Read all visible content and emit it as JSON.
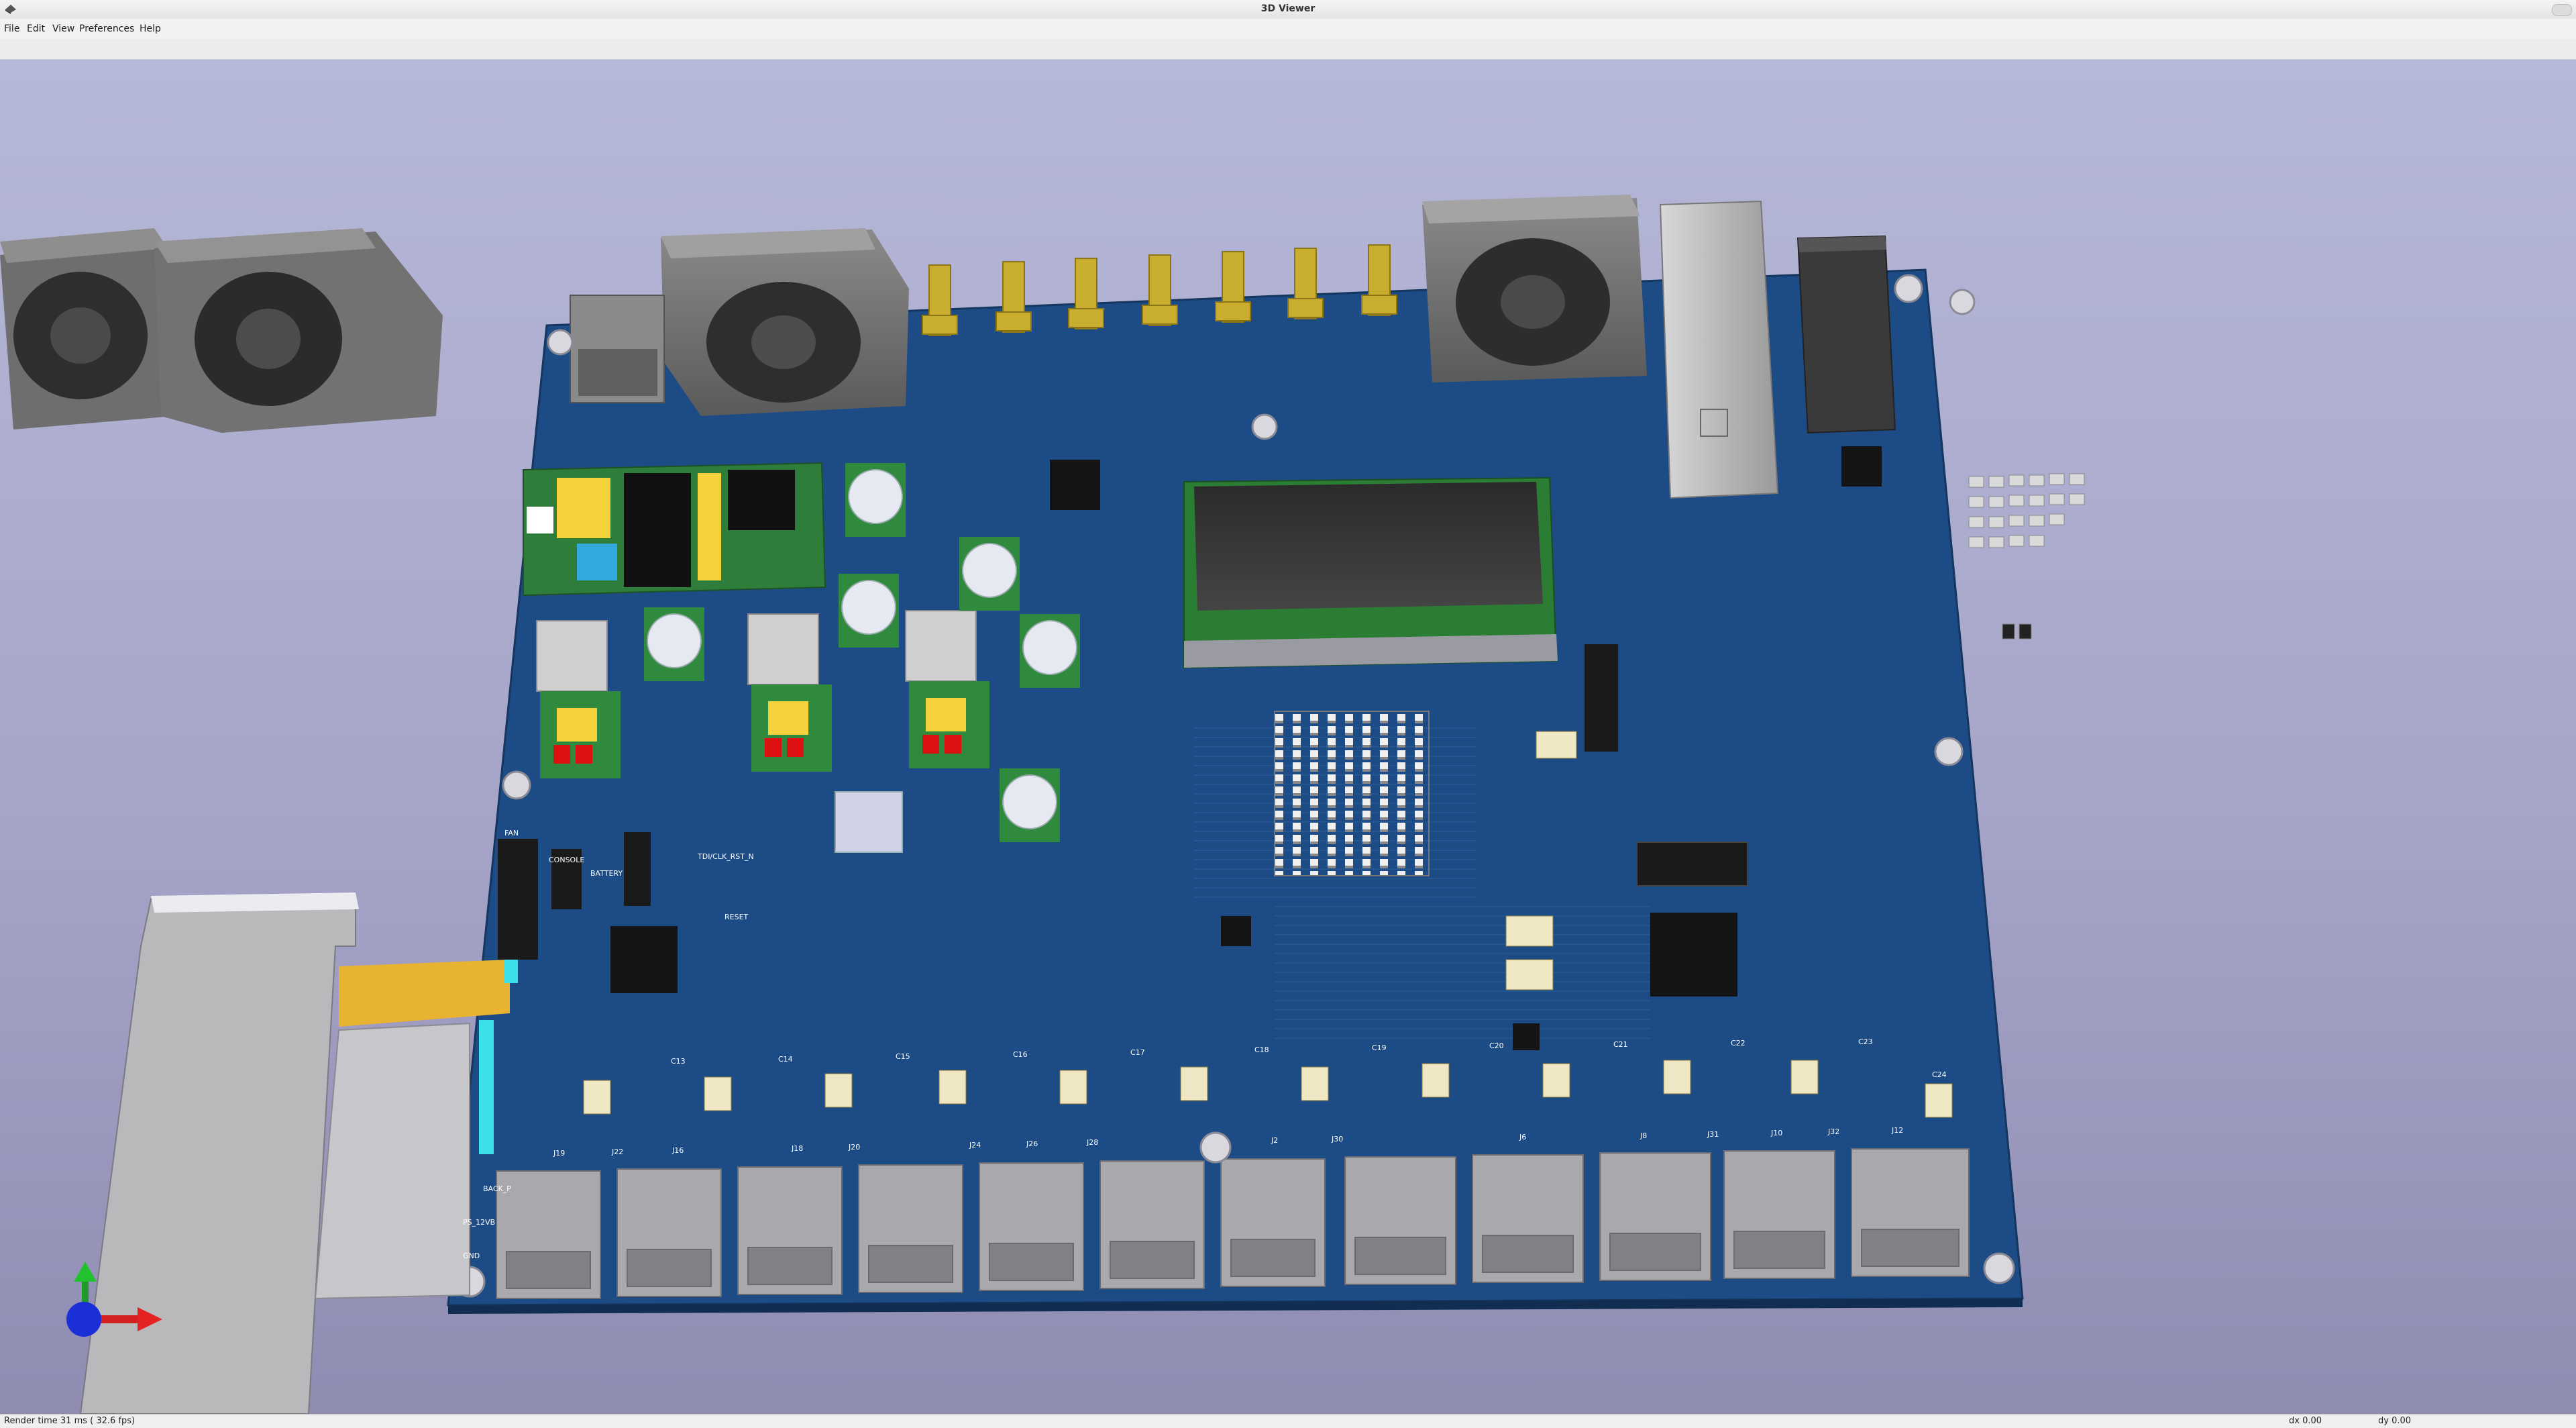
{
  "window": {
    "title": "3D Viewer"
  },
  "menu": {
    "items": [
      "File",
      "Edit",
      "View",
      "Preferences",
      "Help"
    ]
  },
  "board": {
    "silkscreen": {
      "headers": [
        "CONSOLE",
        "BATTERY",
        "TDI/CLK_RST_N",
        "RESET",
        "FAN"
      ],
      "side": [
        "BACK_P",
        "PS_12VB",
        "GND"
      ],
      "caps": [
        "C13",
        "C14",
        "C15",
        "C16",
        "C17",
        "C18",
        "C19",
        "C20",
        "C21",
        "C22",
        "C23",
        "C24"
      ],
      "bottom_refs": [
        "J19",
        "J22",
        "J16",
        "J18",
        "J20",
        "J24",
        "J26",
        "J28",
        "J2",
        "J30",
        "J6",
        "J8",
        "J31",
        "J10",
        "J32",
        "J12"
      ]
    }
  },
  "status": {
    "render_time": "Render time 31 ms ( 32.6 fps)",
    "dx": "dx 0.00",
    "dy": "dy 0.00"
  },
  "colors": {
    "pcb": "#1c4b86",
    "viewport_top": "#b6b8d8",
    "viewport_bottom": "#8f8cb2",
    "connector": "#c9ad2e"
  }
}
